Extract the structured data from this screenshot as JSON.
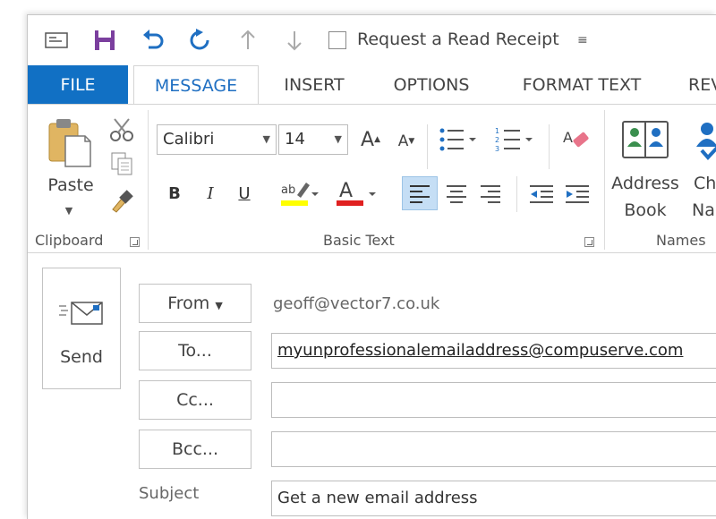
{
  "qat": {
    "read_receipt_label": "Request a Read Receipt",
    "customize_glyph": "≡"
  },
  "tabs": [
    {
      "label": "FILE"
    },
    {
      "label": "MESSAGE"
    },
    {
      "label": "INSERT"
    },
    {
      "label": "OPTIONS"
    },
    {
      "label": "FORMAT TEXT"
    },
    {
      "label": "REVIEW"
    }
  ],
  "ribbon": {
    "clipboard": {
      "group_label": "Clipboard",
      "paste_label": "Paste"
    },
    "basic_text": {
      "group_label": "Basic Text",
      "font_name": "Calibri",
      "font_size": "14",
      "bold": "B",
      "italic": "I",
      "underline": "U",
      "grow_font": "A",
      "shrink_font": "A",
      "highlight_color": "#ffff00",
      "font_color": "#e02020"
    },
    "names": {
      "group_label": "Names",
      "address_book_line1": "Address",
      "address_book_line2": "Book",
      "check_names_line1": "Check",
      "check_names_line2": "Names"
    }
  },
  "compose": {
    "send_label": "Send",
    "from_label": "From",
    "from_value": "geoff@vector7.co.uk",
    "to_label": "To...",
    "to_value": "myunprofessionalemailaddress@compuserve.com",
    "cc_label": "Cc...",
    "cc_value": "",
    "bcc_label": "Bcc...",
    "bcc_value": "",
    "subject_label": "Subject",
    "subject_value": "Get a new email address"
  },
  "colors": {
    "accent": "#1170c4",
    "active_tab_text": "#1f6fc2",
    "save_icon": "#7b3f9e"
  }
}
